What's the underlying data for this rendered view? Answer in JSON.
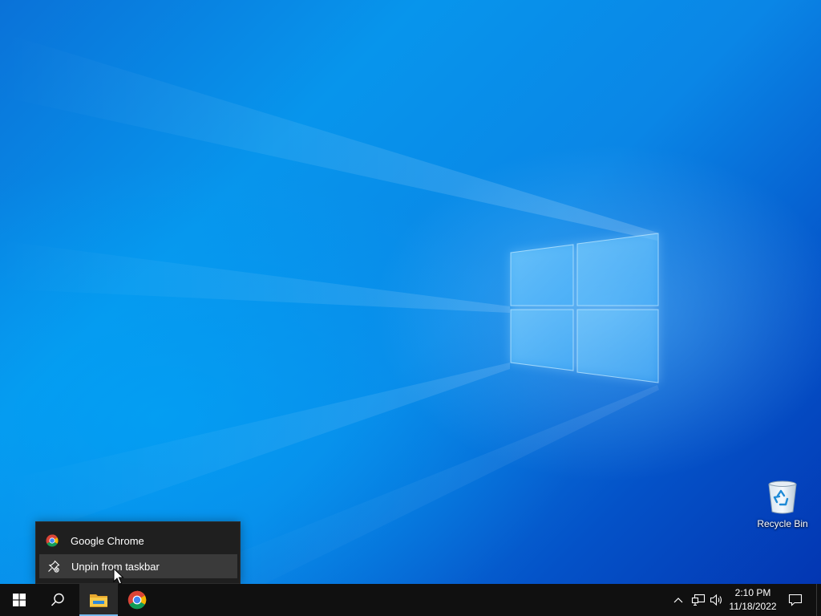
{
  "desktop": {
    "icons": [
      {
        "label": "Recycle Bin",
        "icon": "recycle-bin-icon"
      }
    ]
  },
  "jump_list": {
    "app": {
      "label": "Google Chrome",
      "icon": "chrome-icon"
    },
    "tasks": [
      {
        "label": "Unpin from taskbar",
        "icon": "unpin-icon",
        "highlighted": true
      }
    ]
  },
  "taskbar": {
    "start": {
      "icon": "windows-logo-icon"
    },
    "search": {
      "icon": "search-icon"
    },
    "pinned": [
      {
        "app": "File Explorer",
        "icon": "file-explorer-icon",
        "active": true
      },
      {
        "app": "Google Chrome",
        "icon": "chrome-icon",
        "active": false
      }
    ],
    "tray": {
      "icons": [
        "chevron-up-icon",
        "network-icon",
        "volume-icon"
      ],
      "time": "2:10 PM",
      "date": "11/18/2022",
      "notifications_icon": "action-center-icon"
    }
  },
  "colors": {
    "taskbar": "#101010",
    "jump_list_bg": "#1f1f1f",
    "jump_list_highlight": "#3a3a3a",
    "active_indicator": "#76b9ed",
    "wallpaper_blue": "#0078d7"
  }
}
